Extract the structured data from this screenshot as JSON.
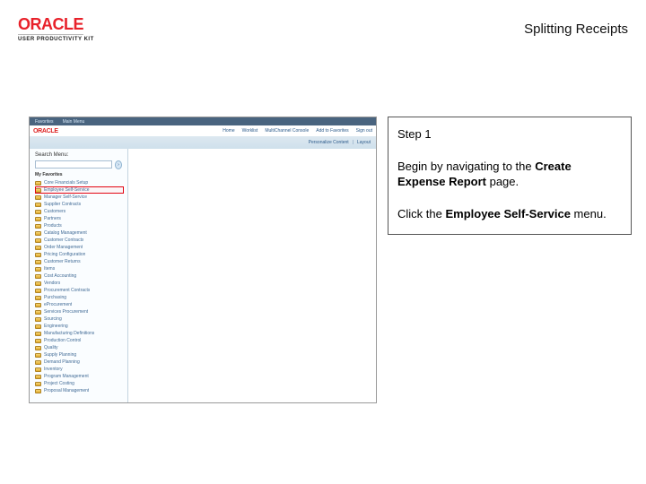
{
  "header": {
    "brand": "ORACLE",
    "subbrand": "USER PRODUCTIVITY KIT",
    "title": "Splitting Receipts"
  },
  "instructions": {
    "step_label": "Step 1",
    "line1a": "Begin by navigating to the ",
    "line1b": "Create Expense Report",
    "line1c": " page.",
    "line2a": "Click the ",
    "line2b": "Employee Self-Service",
    "line2c": " menu."
  },
  "screenshot": {
    "topbar": {
      "item1": "Favorites",
      "item2": "Main Menu"
    },
    "logo": "ORACLE",
    "nav": [
      "Home",
      "Worklist",
      "MultiChannel Console",
      "Add to Favorites",
      "Sign out"
    ],
    "shadebar": {
      "label": "Personalize Content",
      "sep": "|",
      "label2": "Layout"
    },
    "right_text": " ",
    "search_label": "Search Menu:",
    "menu": {
      "section": "My Favorites",
      "items": [
        "Core Financials Setup",
        "Employee Self-Service",
        "Manager Self-Service",
        "Supplier Contracts",
        "Customers",
        "Partners",
        "Products",
        "Catalog Management",
        "Customer Contracts",
        "Order Management",
        "Pricing Configuration",
        "Customer Returns",
        "Items",
        "Cost Accounting",
        "Vendors",
        "Procurement Contracts",
        "Purchasing",
        "eProcurement",
        "Services Procurement",
        "Sourcing",
        "Engineering",
        "Manufacturing Definitions",
        "Production Control",
        "Quality",
        "Supply Planning",
        "Demand Planning",
        "Inventory",
        "Program Management",
        "Project Costing",
        "Proposal Management"
      ]
    },
    "highlight_index": 1
  }
}
